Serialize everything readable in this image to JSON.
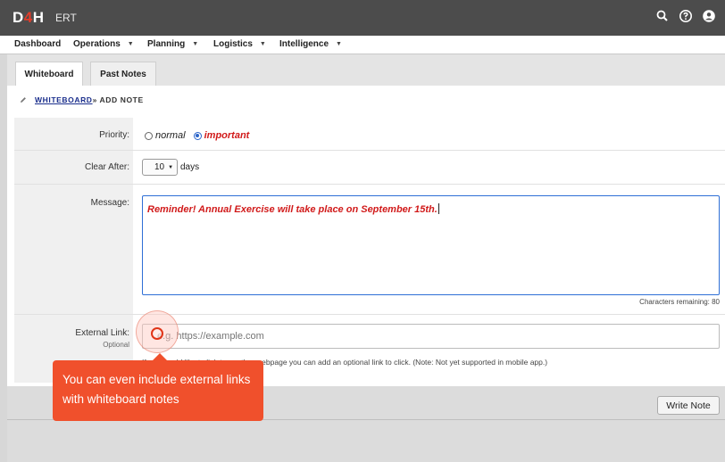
{
  "app": {
    "logo_main": "D",
    "logo_accent": "4",
    "logo_end": "H",
    "name": "ERT"
  },
  "header_icons": [
    "search-icon",
    "help-icon",
    "user-icon"
  ],
  "menu": [
    {
      "label": "Dashboard",
      "has_caret": false
    },
    {
      "label": "Operations",
      "has_caret": true
    },
    {
      "label": "Planning",
      "has_caret": true
    },
    {
      "label": "Logistics",
      "has_caret": true
    },
    {
      "label": "Intelligence",
      "has_caret": true
    }
  ],
  "tabs": [
    {
      "label": "Whiteboard",
      "active": true
    },
    {
      "label": "Past Notes",
      "active": false
    }
  ],
  "breadcrumb": {
    "link": "WHITEBOARD",
    "rest": " » ADD NOTE"
  },
  "form": {
    "priority": {
      "label": "Priority:",
      "options": [
        {
          "label": "normal",
          "checked": false
        },
        {
          "label": "important",
          "checked": true
        }
      ]
    },
    "clear_after": {
      "label": "Clear After:",
      "value": "10",
      "unit": "days"
    },
    "message": {
      "label": "Message:",
      "value": "Reminder! Annual Exercise will take place on September 15th.",
      "chars_remaining": "Characters remaining: 80"
    },
    "external_link": {
      "label": "External Link:",
      "sublabel": "Optional",
      "placeholder": "e.g. https://example.com",
      "hint": "If you would like to link to another webpage you can add an optional link to click. (Note: Not yet supported in mobile app.)"
    }
  },
  "write_button": "Write Note",
  "callout": {
    "text": "You can even include external links with whiteboard notes"
  },
  "colors": {
    "topbar": "#4c4c4c",
    "accent_red": "#d11a1a",
    "callout": "#f0502c",
    "focus_blue": "#2e6fd6"
  }
}
